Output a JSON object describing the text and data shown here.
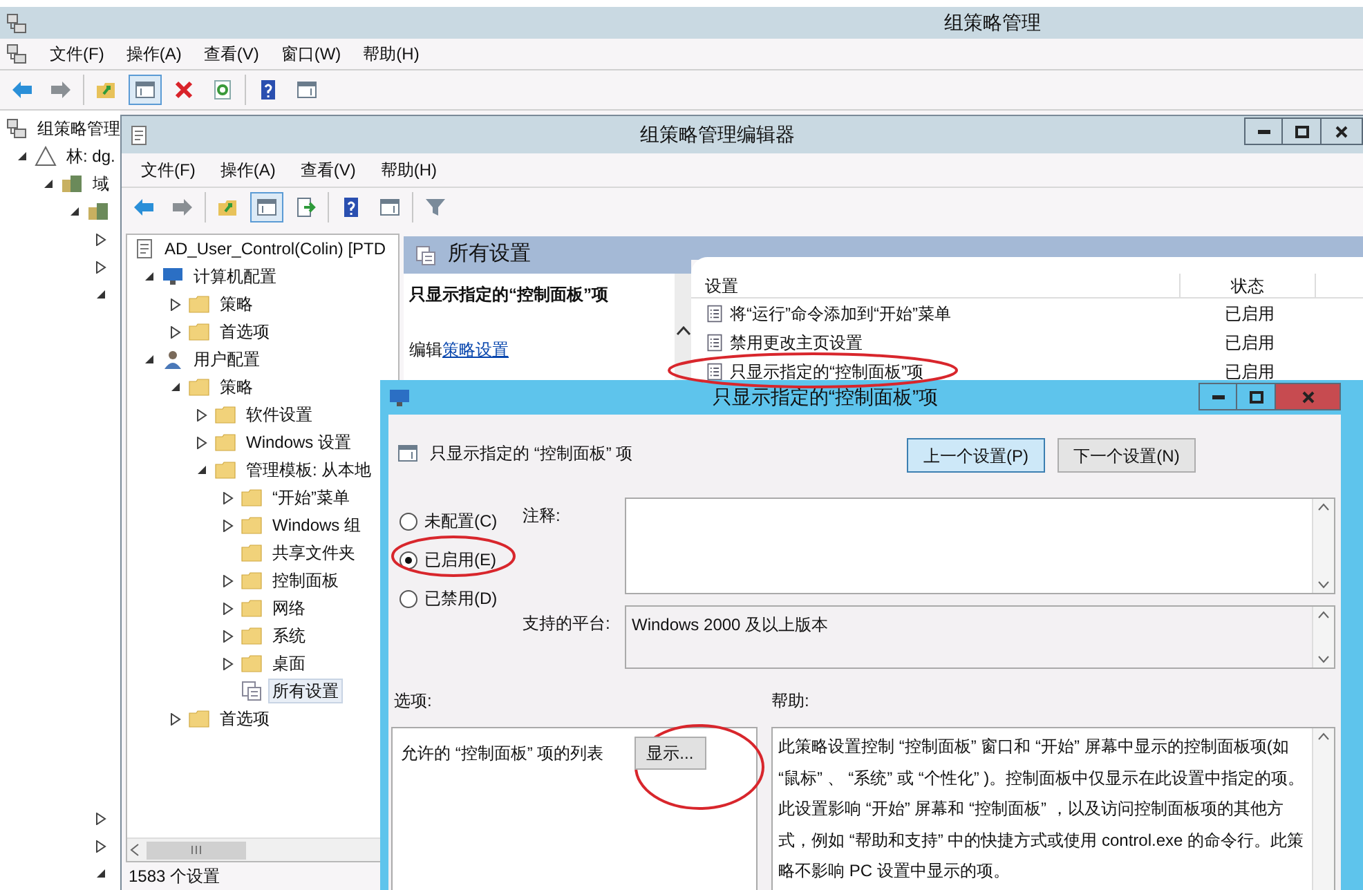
{
  "main_window": {
    "title": "组策略管理",
    "menu": [
      "文件(F)",
      "操作(A)",
      "查看(V)",
      "窗口(W)",
      "帮助(H)"
    ],
    "toolbar_groups": [
      [
        {
          "kind": "back",
          "pressed": false
        },
        {
          "kind": "forward",
          "pressed": false
        }
      ],
      [
        {
          "kind": "up",
          "pressed": false
        },
        {
          "kind": "pane",
          "pressed": true
        },
        {
          "kind": "delete",
          "pressed": false
        },
        {
          "kind": "refresh",
          "pressed": false
        }
      ],
      [
        {
          "kind": "help",
          "pressed": false
        },
        {
          "kind": "panel",
          "pressed": false
        }
      ]
    ],
    "tree": [
      {
        "label": "组策略管理",
        "kind": "console",
        "children": [
          {
            "label": "林: dg.",
            "kind": "forest",
            "expanded": true,
            "children": [
              {
                "label": "域",
                "kind": "domain",
                "expanded": true,
                "children": [
                  {
                    "kind": "domain",
                    "expanded": true,
                    "children": [
                      {
                        "expanded": false
                      },
                      {
                        "expanded": false
                      },
                      {
                        "expanded": true
                      }
                    ]
                  }
                ]
              }
            ]
          }
        ]
      }
    ],
    "lower_nodes": [
      {
        "expanded": false
      },
      {
        "expanded": false
      },
      {
        "expanded": true
      }
    ]
  },
  "editor_window": {
    "title": "组策略管理编辑器",
    "menu": [
      "文件(F)",
      "操作(A)",
      "查看(V)",
      "帮助(H)"
    ],
    "toolbar_groups": [
      [
        {
          "kind": "back",
          "pressed": false
        },
        {
          "kind": "forward",
          "pressed": false
        }
      ],
      [
        {
          "kind": "up",
          "pressed": false
        },
        {
          "kind": "pane",
          "pressed": true
        },
        {
          "kind": "export",
          "pressed": false
        }
      ],
      [
        {
          "kind": "help",
          "pressed": false
        },
        {
          "kind": "panel",
          "pressed": false
        }
      ],
      [
        {
          "kind": "filter",
          "pressed": false
        }
      ]
    ],
    "tree": [
      {
        "label": "AD_User_Control(Colin) [PTD",
        "kind": "document",
        "selected": false,
        "children": [
          {
            "label": "计算机配置",
            "kind": "computer",
            "expanded": true,
            "selected": false,
            "children": [
              {
                "label": "策略",
                "kind": "folder",
                "expanded": false,
                "selected": false
              },
              {
                "label": "首选项",
                "kind": "folder",
                "expanded": false,
                "selected": false
              }
            ]
          },
          {
            "label": "用户配置",
            "kind": "user",
            "expanded": true,
            "selected": false,
            "children": [
              {
                "label": "策略",
                "kind": "folder",
                "expanded": true,
                "selected": false,
                "children": [
                  {
                    "label": "软件设置",
                    "kind": "folder",
                    "expanded": false,
                    "selected": false
                  },
                  {
                    "label": "Windows 设置",
                    "kind": "folder",
                    "expanded": false,
                    "selected": false
                  },
                  {
                    "label": "管理模板: 从本地",
                    "kind": "folder",
                    "expanded": true,
                    "selected": false,
                    "children": [
                      {
                        "label": "“开始”菜单",
                        "kind": "folder",
                        "expanded": false,
                        "selected": false
                      },
                      {
                        "label": "Windows 组",
                        "kind": "folder",
                        "expanded": false,
                        "selected": false
                      },
                      {
                        "label": "共享文件夹",
                        "kind": "folder",
                        "selected": false
                      },
                      {
                        "label": "控制面板",
                        "kind": "folder",
                        "expanded": false,
                        "selected": false
                      },
                      {
                        "label": "网络",
                        "kind": "folder",
                        "expanded": false,
                        "selected": false
                      },
                      {
                        "label": "系统",
                        "kind": "folder",
                        "expanded": false,
                        "selected": false
                      },
                      {
                        "label": "桌面",
                        "kind": "folder",
                        "expanded": false,
                        "selected": false
                      },
                      {
                        "label": "所有设置",
                        "kind": "allsettings",
                        "selected": true
                      }
                    ]
                  }
                ]
              },
              {
                "label": "首选项",
                "kind": "folder",
                "expanded": false,
                "selected": false
              }
            ]
          }
        ]
      }
    ],
    "status_bar": "1583 个设置",
    "panel_title": "所有设置",
    "description": {
      "title": "只显示指定的“控制面板”项",
      "edit_prefix": "编辑",
      "edit_link": "策略设置"
    },
    "table": {
      "columns": [
        "设置",
        "状态"
      ],
      "rows": [
        {
          "setting": "将“运行”命令添加到“开始”菜单",
          "state": "已启用"
        },
        {
          "setting": "禁用更改主页设置",
          "state": "已启用"
        },
        {
          "setting": "只显示指定的“控制面板”项",
          "state": "已启用"
        }
      ]
    }
  },
  "dialog": {
    "title": "只显示指定的“控制面板”项",
    "heading": "只显示指定的 “控制面板” 项",
    "nav_buttons": [
      {
        "label": "上一个设置(P)",
        "focused": true
      },
      {
        "label": "下一个设置(N)",
        "focused": false
      }
    ],
    "options": [
      {
        "label": "未配置(C)",
        "selected": false
      },
      {
        "label": "已启用(E)",
        "selected": true
      },
      {
        "label": "已禁用(D)",
        "selected": false
      }
    ],
    "comment_label": "注释:",
    "platform_label": "支持的平台:",
    "platform": "Windows 2000 及以上版本",
    "options_label": "选项:",
    "help_label": "帮助:",
    "list_label": "允许的 “控制面板” 项的列表",
    "show_button": "显示...",
    "help_text": "此策略设置控制 “控制面板” 窗口和 “开始” 屏幕中显示的控制面板项(如 “鼠标” 、 “系统” 或 “个性化” )。控制面板中仅显示在此设置中指定的项。此设置影响 “开始” 屏幕和 “控制面板” ，以及访问控制面板项的其他方式，例如 “帮助和支持” 中的快捷方式或使用 control.exe 的命令行。此策略不影响 PC 设置中显示的项。"
  }
}
